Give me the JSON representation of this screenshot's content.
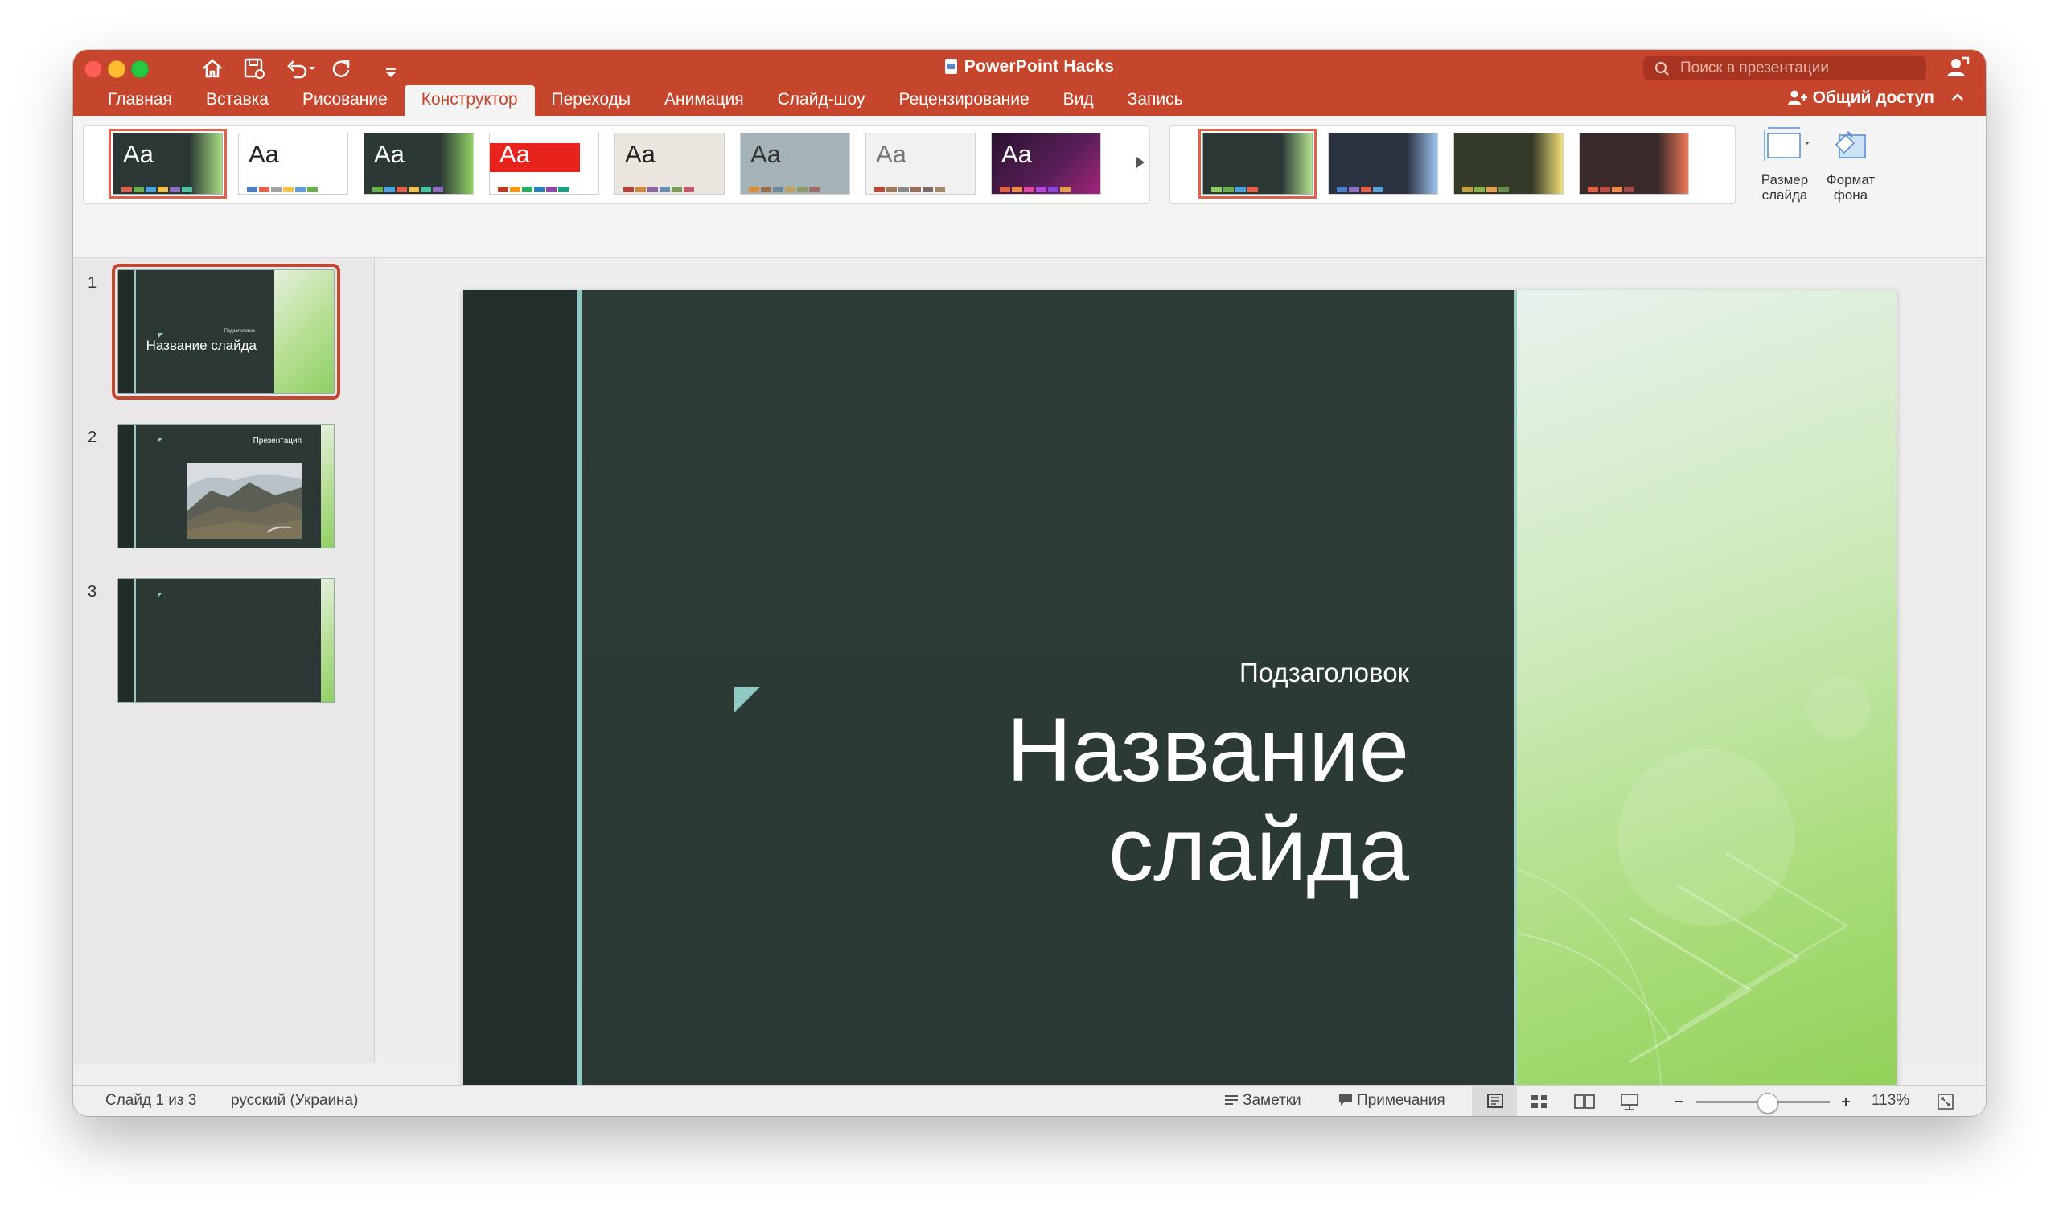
{
  "app": {
    "document_title": "PowerPoint Hacks",
    "search_placeholder": "Поиск в презентации",
    "share_label": "Общий доступ"
  },
  "tabs": [
    {
      "label": "Главная"
    },
    {
      "label": "Вставка"
    },
    {
      "label": "Рисование"
    },
    {
      "label": "Конструктор",
      "active": true
    },
    {
      "label": "Переходы"
    },
    {
      "label": "Анимация"
    },
    {
      "label": "Слайд-шоу"
    },
    {
      "label": "Рецензирование"
    },
    {
      "label": "Вид"
    },
    {
      "label": "Запись"
    }
  ],
  "ribbon": {
    "themes": [
      {
        "label": "Aa",
        "bg": "#2b3835",
        "fg": "#ffffff",
        "accent": "#a9dd7f",
        "selected": true
      },
      {
        "label": "Aa",
        "bg": "#ffffff",
        "fg": "#222222",
        "accent": "#ffffff"
      },
      {
        "label": "Aa",
        "bg": "#2b3835",
        "fg": "#ffffff",
        "accent": "#8fd063"
      },
      {
        "label": "Aa",
        "bg": "#ffffff",
        "fg": "#ffffff",
        "accent": "#e8231b"
      },
      {
        "label": "Aa",
        "bg": "#eae6df",
        "fg": "#222222",
        "accent": "#d8d2c6"
      },
      {
        "label": "Aa",
        "bg": "#a3b3b8",
        "fg": "#333333",
        "accent": "#a3b3b8"
      },
      {
        "label": "Aa",
        "bg": "#f1f1f1",
        "fg": "#777777",
        "accent": "#e4e4e4"
      },
      {
        "label": "Aa",
        "bg": "#3a1a45",
        "fg": "#ffffff",
        "accent": "#a2247a"
      }
    ],
    "variants": [
      {
        "bg": "#2b3835",
        "accent": "#b3e08f",
        "selected": true
      },
      {
        "bg": "#2b3340",
        "accent": "#9dc3f0"
      },
      {
        "bg": "#343a2a",
        "accent": "#f2e07a"
      },
      {
        "bg": "#3a2a2a",
        "accent": "#f0785a"
      }
    ],
    "slide_size_label": "Размер слайда",
    "format_background_label": "Формат фона"
  },
  "slides": [
    {
      "number": "1",
      "title": "Название слайда",
      "subtitle": "Подзаголовок",
      "selected": true
    },
    {
      "number": "2",
      "title": "Презентация",
      "has_photo": true
    },
    {
      "number": "3"
    }
  ],
  "current_slide": {
    "subtitle": "Подзаголовок",
    "title_line1": "Название",
    "title_line2": "слайда"
  },
  "status": {
    "slide_counter": "Слайд 1 из 3",
    "language": "русский (Украина)",
    "notes_label": "Заметки",
    "comments_label": "Примечания",
    "zoom": "113%"
  }
}
